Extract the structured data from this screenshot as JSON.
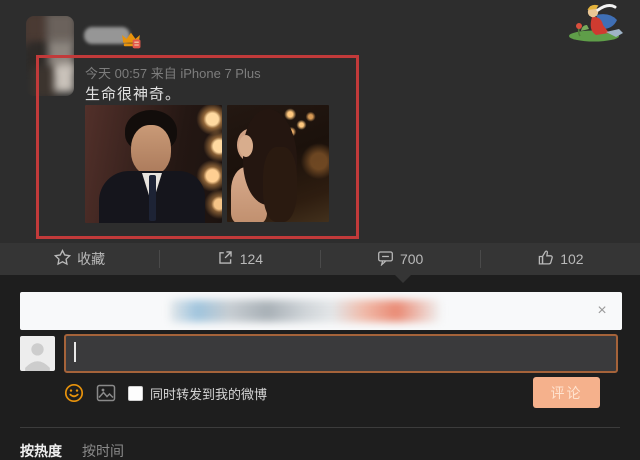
{
  "post": {
    "timestamp": "今天 00:57 来自 iPhone 7 Plus",
    "content": "生命很神奇。"
  },
  "action_bar": {
    "favorite_label": "收藏",
    "repost_count": "124",
    "comment_count": "700",
    "like_count": "102"
  },
  "composer": {
    "close": "×",
    "input_value": "",
    "repost_checkbox_label": "同时转发到我的微博",
    "submit_label": "评论"
  },
  "tabs": {
    "by_hot": "按热度",
    "by_time": "按时间"
  },
  "colors": {
    "highlight_red": "#c23a3a",
    "accent_orange": "#e8930c",
    "submit_button_bg": "#f5b18c",
    "panel_bg": "#1e1e1e",
    "post_bg": "#2d2d2d"
  }
}
